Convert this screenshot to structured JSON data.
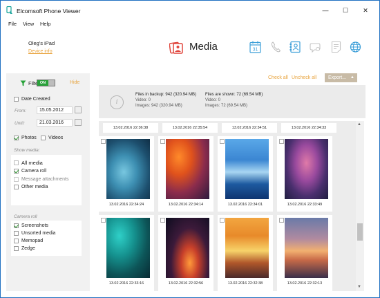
{
  "window": {
    "title": "Elcomsoft Phone Viewer",
    "controls": [
      "—",
      "☐",
      "✕"
    ]
  },
  "menu": [
    "File",
    "View",
    "Help"
  ],
  "device": {
    "name": "Oleg's iPad",
    "info_link": "Device info"
  },
  "page": {
    "title": "Media"
  },
  "toolbar_icons": [
    "calendar-icon",
    "phone-icon",
    "contacts-icon",
    "messages-icon",
    "notes-icon",
    "web-icon"
  ],
  "calendar_day": "31",
  "colors": {
    "accent": "#17a39a",
    "orange": "#e8a33c",
    "media_red": "#e0453c",
    "toggle_green": "#29a23a"
  },
  "filter": {
    "label": "Filter",
    "toggle": "ON",
    "hide": "Hide",
    "date_created": "Date Created",
    "from_label": "From:",
    "from_value": "15.05.2012",
    "until_label": "Until:",
    "until_value": "21.03.2016",
    "photos": "Photos",
    "videos": "Videos",
    "show_media_header": "Show media:",
    "show_media": [
      {
        "label": "All media",
        "checked": false
      },
      {
        "label": "Camera roll",
        "checked": true
      },
      {
        "label": "Message attachments",
        "checked": false
      },
      {
        "label": "Other media",
        "checked": false
      }
    ],
    "camera_roll_header": "Camera roll",
    "camera_roll": [
      {
        "label": "Screenshots",
        "checked": true
      },
      {
        "label": "Unsorted media",
        "checked": false
      },
      {
        "label": "Memopad",
        "checked": false
      },
      {
        "label": "Zedge",
        "checked": false
      }
    ]
  },
  "actions": {
    "check_all": "Check all",
    "uncheck_all": "Uncheck all",
    "export": "Export..."
  },
  "info": {
    "backup_line": "Files in backup: 942 (320.94 MB)",
    "backup_video": "Video: 0",
    "backup_images": "Images: 942 (320.94 MB)",
    "shown_line": "Files are shown: 72 (69.54 MB)",
    "shown_video": "Video: 0",
    "shown_images": "Images: 72 (69.54 MB)"
  },
  "top_timestamps": [
    "13.02.2016 22:36:38",
    "13.02.2016 22:35:54",
    "13.02.2016 22:34:51",
    "13.02.2016 22:34:33"
  ],
  "photos": [
    {
      "caption": "13.02.2016 22:34:24",
      "gradient": "radial-gradient(ellipse at 40% 55%,#78c7e0 0%,#3d8fb2 35%,#1d4f6e 70%,#0f2e45 100%)"
    },
    {
      "caption": "13.02.2016 22:34:14",
      "gradient": "radial-gradient(ellipse at 30% 30%,#ff8a2a 0%,#e0521c 30%,#8c2c4c 60%,#2b1a3e 100%)"
    },
    {
      "caption": "13.02.2016 22:34:01",
      "gradient": "linear-gradient(180deg,#5aa8e8 0%,#3b86d2 35%,#a8d6f2 55%,#1d5aa0 75%,#0f3570 100%)"
    },
    {
      "caption": "13.02.2016 22:33:49",
      "gradient": "radial-gradient(ellipse at 50% 40%,#e07aa8 0%,#9a4a9e 35%,#4a2f6e 65%,#1f1e40 100%)"
    },
    {
      "caption": "13.02.2016 22:33:16",
      "gradient": "radial-gradient(ellipse at 30% 30%,#2fd0c8 0%,#15918e 35%,#0d5558 65%,#082a33 100%)"
    },
    {
      "caption": "13.02.2016 22:32:56",
      "gradient": "radial-gradient(ellipse at 55% 75%,#ff9a3a 0%,#c8402a 25%,#3c1a3a 55%,#0c0c1e 100%)"
    },
    {
      "caption": "13.02.2016 22:32:38",
      "gradient": "linear-gradient(180deg,#f2a640 0%,#e88a2a 30%,#f7d36a 55%,#b0562a 75%,#4a2a2a 100%)"
    },
    {
      "caption": "13.02.2016 22:32:13",
      "gradient": "linear-gradient(180deg,#6a7aa8 0%,#b08aa0 35%,#f2b070 55%,#c86a48 70%,#3a2f4a 100%)"
    }
  ]
}
